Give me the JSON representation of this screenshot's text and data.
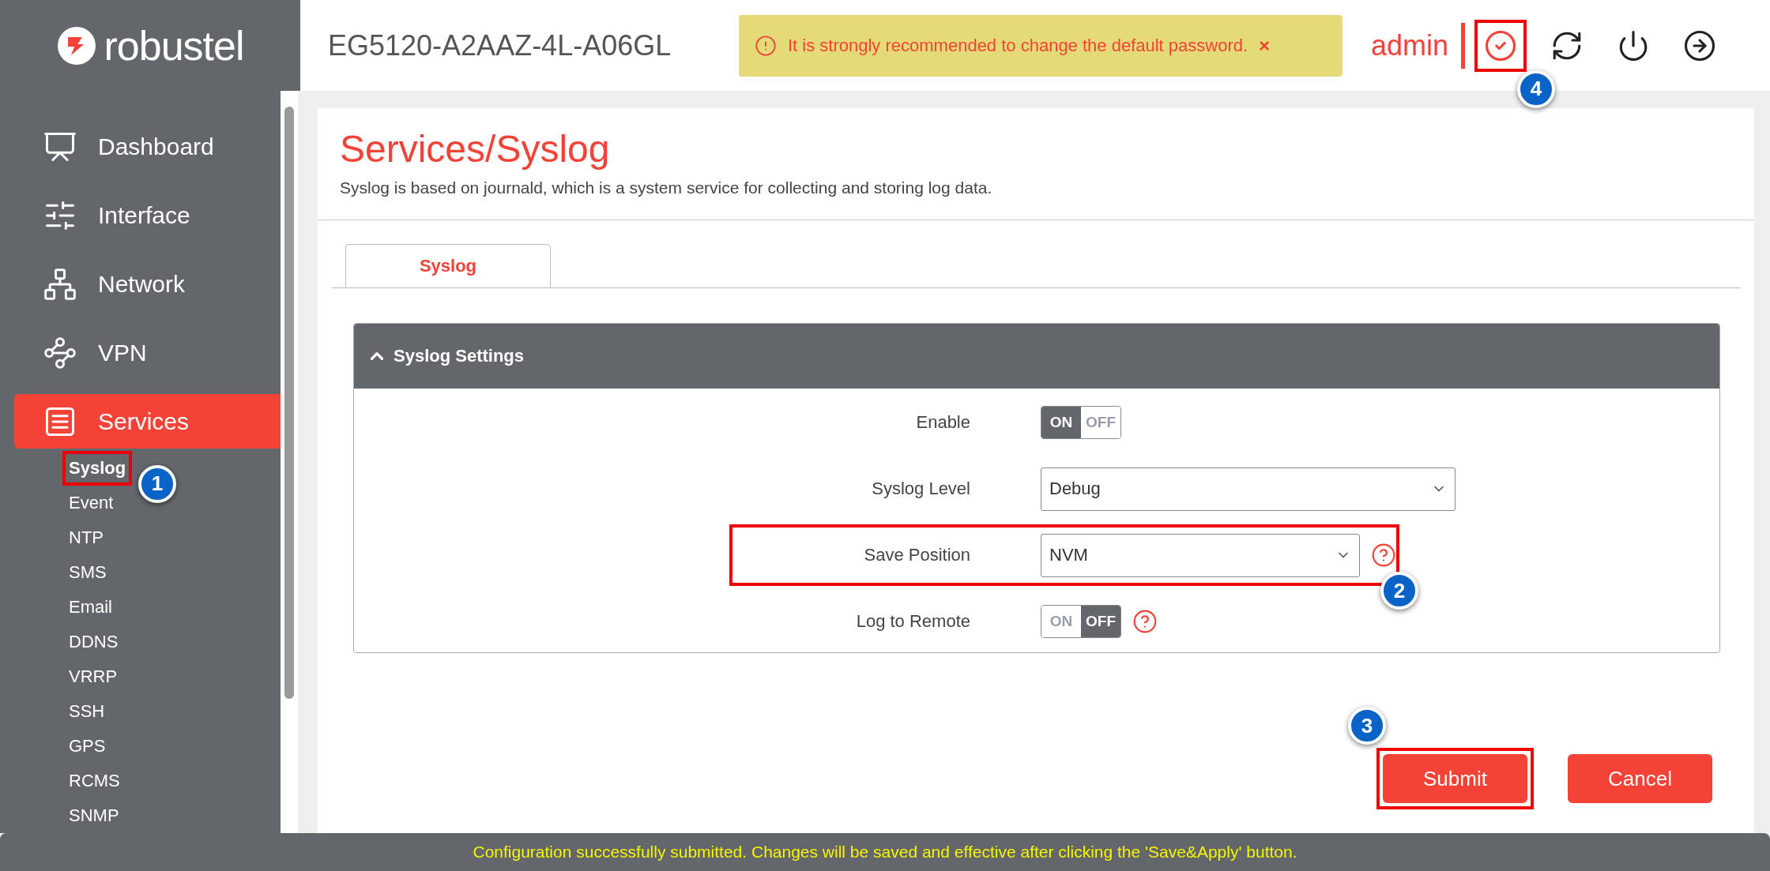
{
  "header": {
    "logo": "robustel",
    "device": "EG5120-A2AAZ-4L-A06GL",
    "alert": "It is strongly recommended to change the default password.",
    "alert_close": "×",
    "user": "admin",
    "actions": [
      {
        "kind": "save",
        "callout": "4"
      },
      {
        "kind": "refresh"
      },
      {
        "kind": "reboot"
      },
      {
        "kind": "logout"
      }
    ]
  },
  "sidebar": {
    "items": [
      {
        "label": "Dashboard",
        "kind": "dashboard",
        "selected": false
      },
      {
        "label": "Interface",
        "kind": "interface",
        "selected": false
      },
      {
        "label": "Network",
        "kind": "network",
        "selected": false
      },
      {
        "label": "VPN",
        "kind": "vpn",
        "selected": false
      },
      {
        "label": "Services",
        "kind": "services",
        "selected": true,
        "children": [
          {
            "label": "Syslog",
            "selected": true,
            "callout": "1"
          },
          {
            "label": "Event",
            "selected": false
          },
          {
            "label": "NTP",
            "selected": false
          },
          {
            "label": "SMS",
            "selected": false
          },
          {
            "label": "Email",
            "selected": false
          },
          {
            "label": "DDNS",
            "selected": false
          },
          {
            "label": "VRRP",
            "selected": false
          },
          {
            "label": "SSH",
            "selected": false
          },
          {
            "label": "GPS",
            "selected": false
          },
          {
            "label": "RCMS",
            "selected": false
          },
          {
            "label": "SNMP",
            "selected": false
          }
        ]
      }
    ]
  },
  "page": {
    "title": "Services/Syslog",
    "description": "Syslog is based on journald, which is a system service for collecting and storing log data.",
    "tabs": [
      {
        "label": "Syslog",
        "selected": true
      }
    ],
    "panel": {
      "title": "Syslog Settings",
      "expanded": true,
      "fields": [
        {
          "kind": "toggle",
          "label": "Enable",
          "on": true,
          "on_label": "ON",
          "off_label": "OFF",
          "help": false
        },
        {
          "kind": "select",
          "label": "Syslog Level",
          "value": "Debug",
          "help": false
        },
        {
          "kind": "select",
          "label": "Save Position",
          "value": "NVM",
          "help": true,
          "callout": "2"
        },
        {
          "kind": "toggle",
          "label": "Log to Remote",
          "on": false,
          "on_label": "ON",
          "off_label": "OFF",
          "help": true
        }
      ]
    },
    "buttons": [
      {
        "label": "Submit",
        "callout": "3"
      },
      {
        "label": "Cancel"
      }
    ]
  },
  "status_bar": {
    "message": "Configuration successfully submitted. Changes will be saved and effective after clicking the 'Save&Apply' button."
  }
}
